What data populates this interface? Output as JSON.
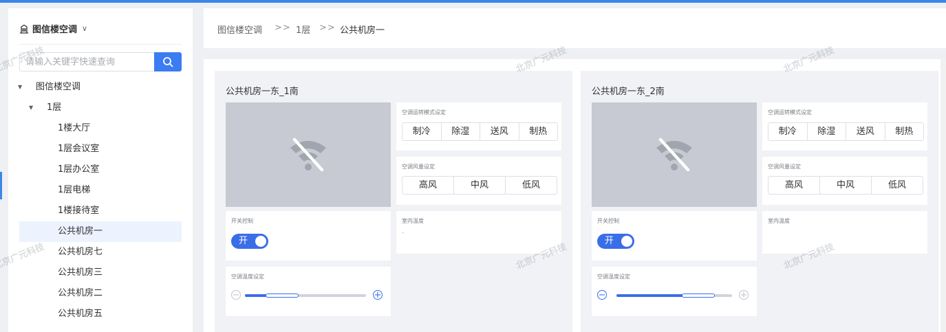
{
  "sidebar": {
    "title": "图信楼空调",
    "search_placeholder": "请输入关键字快速查询",
    "tree": [
      {
        "label": "图信楼空调",
        "level": 0,
        "expanded": true
      },
      {
        "label": "1层",
        "level": 1,
        "expanded": true
      },
      {
        "label": "1楼大厅",
        "level": 2
      },
      {
        "label": "1层会议室",
        "level": 2
      },
      {
        "label": "1层办公室",
        "level": 2
      },
      {
        "label": "1层电梯",
        "level": 2
      },
      {
        "label": "1楼接待室",
        "level": 2
      },
      {
        "label": "公共机房一",
        "level": 2,
        "selected": true
      },
      {
        "label": "公共机房七",
        "level": 2
      },
      {
        "label": "公共机房三",
        "level": 2
      },
      {
        "label": "公共机房二",
        "level": 2
      },
      {
        "label": "公共机房五",
        "level": 2
      }
    ]
  },
  "breadcrumb": {
    "items": [
      "图信楼空调",
      "1层",
      "公共机房一"
    ],
    "separator": ">>"
  },
  "watermark": "北京广元科技",
  "labels": {
    "mode": "空调运转模式设定",
    "fan": "空调风量设定",
    "power": "开关控制",
    "indoor_temp": "室内温度",
    "temp_set": "空调温度设定"
  },
  "modes": [
    "制冷",
    "除湿",
    "送风",
    "制热"
  ],
  "fan_speeds": [
    "高风",
    "中风",
    "低风"
  ],
  "units": [
    {
      "name": "公共机房一东_1南",
      "power_label": "开",
      "power_on": true,
      "indoor_temp": "-",
      "temp_level": 0.3
    },
    {
      "name": "公共机房一东_2南",
      "power_label": "开",
      "power_on": true,
      "indoor_temp": "",
      "temp_level": 0.7
    }
  ],
  "colors": {
    "accent": "#3b7cf3",
    "top_bar": "#3b86e8",
    "camera_bg": "#c7cad3"
  },
  "icons": {
    "building": "building-icon",
    "search": "search-icon",
    "no_signal": "wifi-off-icon"
  }
}
